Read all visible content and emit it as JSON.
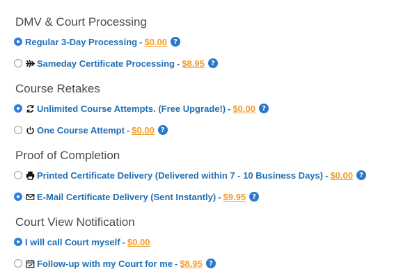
{
  "sections": [
    {
      "title": "DMV & Court Processing",
      "options": [
        {
          "label": "Regular 3-Day Processing",
          "price": "$0.00",
          "selected": true,
          "icon": null,
          "help": true
        },
        {
          "label": "Sameday Certificate Processing",
          "price": "$8.95",
          "selected": false,
          "icon": "plane-icon",
          "help": true
        }
      ]
    },
    {
      "title": "Course Retakes",
      "options": [
        {
          "label": "Unlimited Course Attempts. (Free Upgrade!)",
          "price": "$0.00",
          "selected": true,
          "icon": "refresh-icon",
          "help": true
        },
        {
          "label": "One Course Attempt",
          "price": "$0.00",
          "selected": false,
          "icon": "power-icon",
          "help": true
        }
      ]
    },
    {
      "title": "Proof of Completion",
      "options": [
        {
          "label": "Printed Certificate Delivery (Delivered within 7 - 10 Business Days)",
          "price": "$0.00",
          "selected": false,
          "icon": "printer-icon",
          "help": true
        },
        {
          "label": "E-Mail Certificate Delivery (Sent Instantly)",
          "price": "$9.95",
          "selected": true,
          "icon": "envelope-icon",
          "help": true
        }
      ]
    },
    {
      "title": "Court View Notification",
      "options": [
        {
          "label": "I will call Court myself",
          "price": "$0.00",
          "selected": true,
          "icon": null,
          "help": false
        },
        {
          "label": "Follow-up with my Court for me",
          "price": "$8.95",
          "selected": false,
          "icon": "calendar-check-icon",
          "help": true
        }
      ]
    }
  ],
  "separator": "-",
  "help_glyph": "?",
  "colors": {
    "section_title": "#4a4a4a",
    "label": "#1f6fb3",
    "price": "#f39c2c",
    "radio_selected": "#2f7fe0",
    "help_badge": "#2a78c8"
  }
}
